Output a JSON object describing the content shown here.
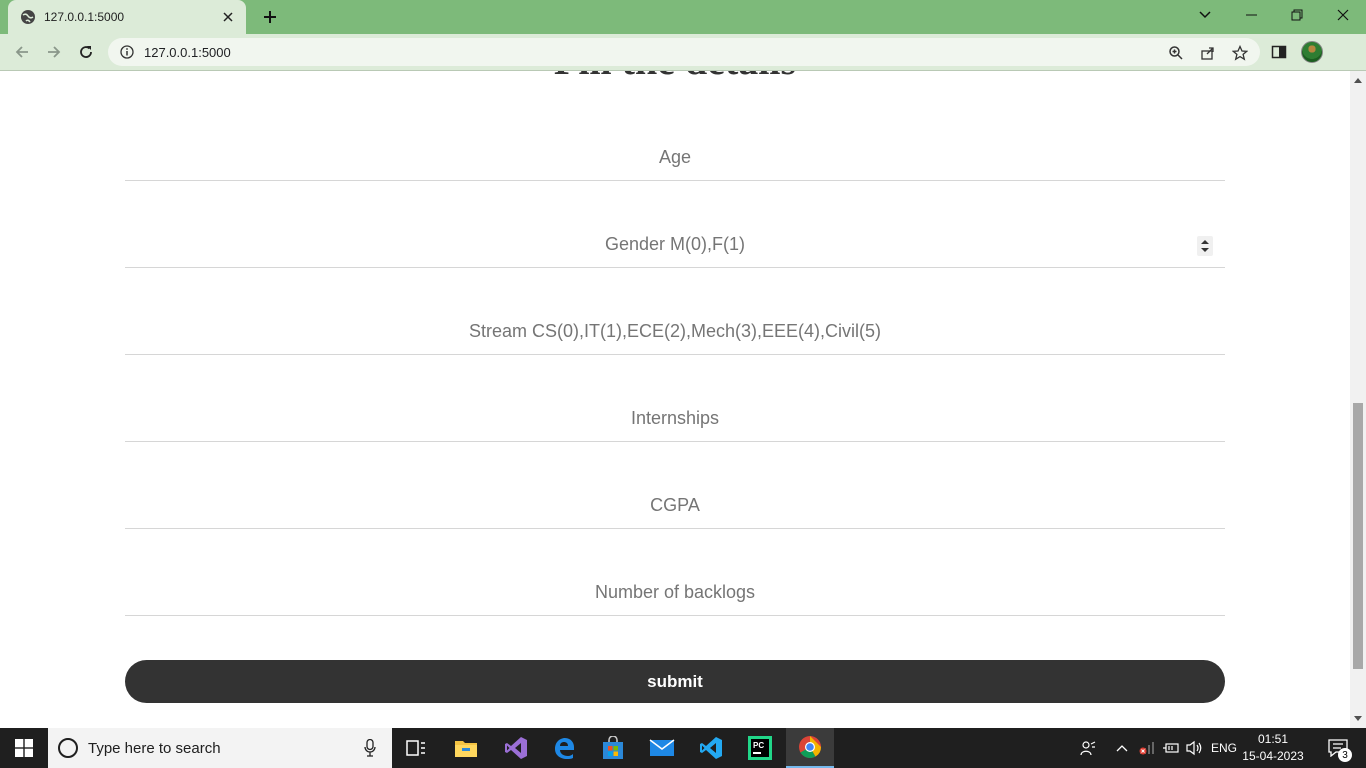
{
  "browser": {
    "tab_title": "127.0.0.1:5000",
    "url": "127.0.0.1:5000"
  },
  "page": {
    "heading": "Fill the details",
    "fields": [
      {
        "name": "age",
        "placeholder": "Age"
      },
      {
        "name": "gender",
        "placeholder": "Gender M(0),F(1)"
      },
      {
        "name": "stream",
        "placeholder": "Stream CS(0),IT(1),ECE(2),Mech(3),EEE(4),Civil(5)"
      },
      {
        "name": "internships",
        "placeholder": "Internships"
      },
      {
        "name": "cgpa",
        "placeholder": "CGPA"
      },
      {
        "name": "backlogs",
        "placeholder": "Number of backlogs"
      }
    ],
    "submit_label": "submit"
  },
  "taskbar": {
    "search_placeholder": "Type here to search",
    "language": "ENG",
    "time": "01:51",
    "date": "15-04-2023",
    "notification_count": "3",
    "apps": [
      "task-view",
      "file-explorer",
      "visual-studio",
      "edge",
      "microsoft-store",
      "mail",
      "vscode",
      "pycharm",
      "chrome"
    ]
  },
  "colors": {
    "chrome_tabbar": "#7dba7a",
    "chrome_toolbar": "#dcebd8",
    "submit_bg": "#333333",
    "taskbar_bg": "#1f1f1f"
  }
}
